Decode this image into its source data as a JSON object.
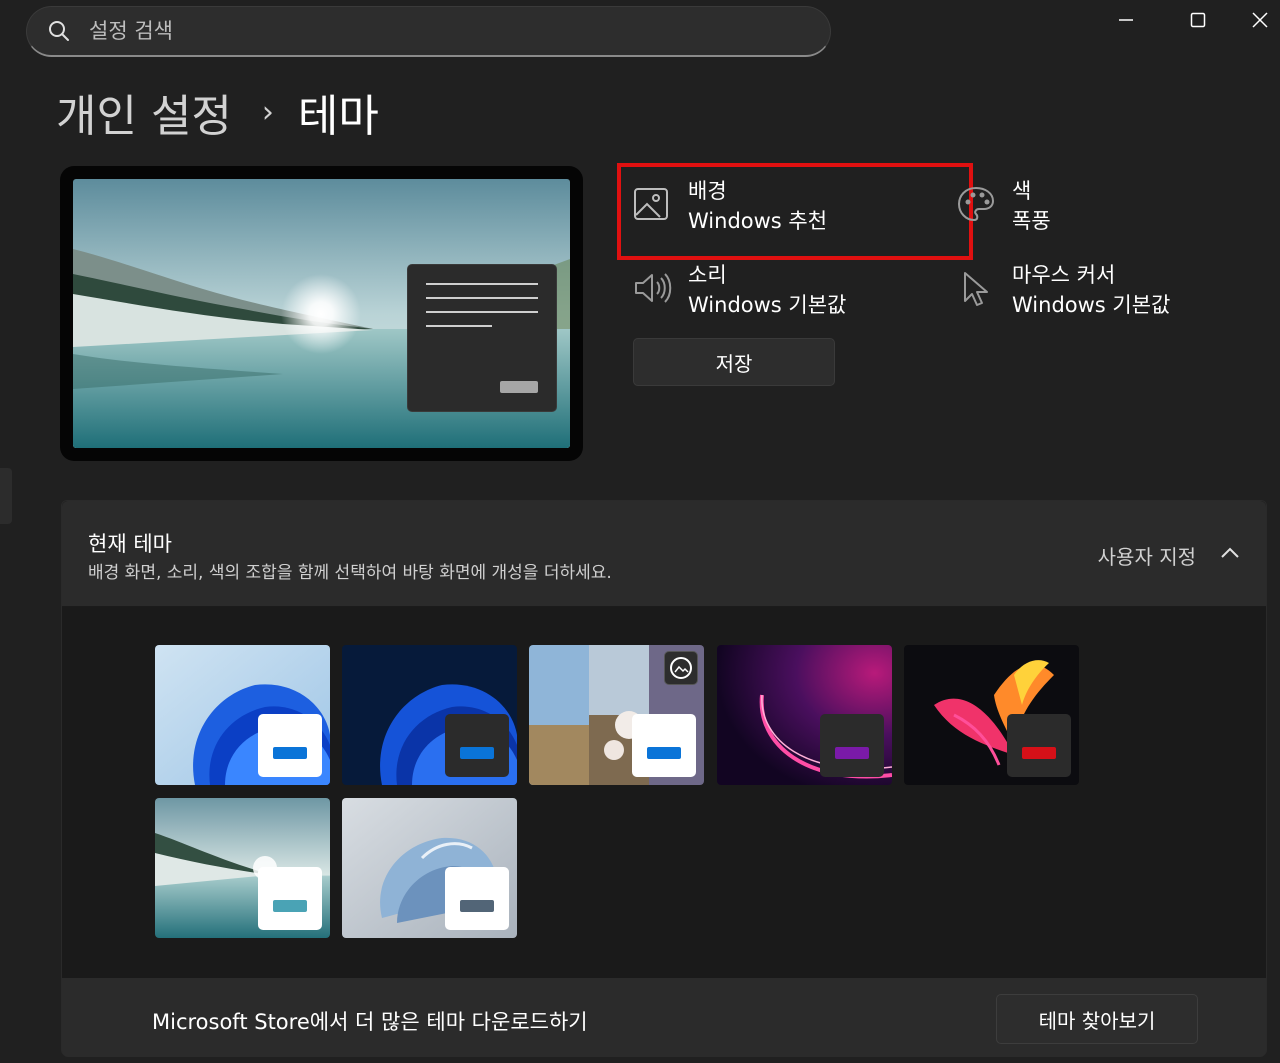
{
  "search": {
    "placeholder": "설정 검색"
  },
  "breadcrumb": {
    "parent": "개인 설정",
    "separator": "›",
    "current": "테마"
  },
  "properties": {
    "background": {
      "label": "배경",
      "value": "Windows 추천",
      "icon": "picture-icon"
    },
    "color": {
      "label": "색",
      "value": "폭풍",
      "icon": "palette-icon"
    },
    "sound": {
      "label": "소리",
      "value": "Windows 기본값",
      "icon": "speaker-icon"
    },
    "cursor": {
      "label": "마우스 커서",
      "value": "Windows 기본값",
      "icon": "cursor-icon"
    }
  },
  "save_button": "저장",
  "current_theme": {
    "title": "현재 테마",
    "description": "배경 화면, 소리, 색의 조합을 함께 선택하여 바탕 화면에 개성을 더하세요.",
    "value": "사용자 지정",
    "themes": [
      {
        "accent": "#0a74d8",
        "badge": "#ffffff"
      },
      {
        "accent": "#0a74d8",
        "badge": "#2b2b2b"
      },
      {
        "accent": "#0a74d8",
        "badge": "#ffffff"
      },
      {
        "accent": "#7a1aa8",
        "badge": "#2b2b2b"
      },
      {
        "accent": "#d61018",
        "badge": "#2b2b2b"
      },
      {
        "accent": "#4aa3b5",
        "badge": "#ffffff"
      },
      {
        "accent": "#526577",
        "badge": "#ffffff"
      }
    ]
  },
  "store": {
    "text": "Microsoft Store에서 더 많은 테마 다운로드하기",
    "button": "테마 찾아보기"
  },
  "colors": {
    "highlight": "#e01010",
    "background": "#202020",
    "card": "#2b2b2b"
  }
}
